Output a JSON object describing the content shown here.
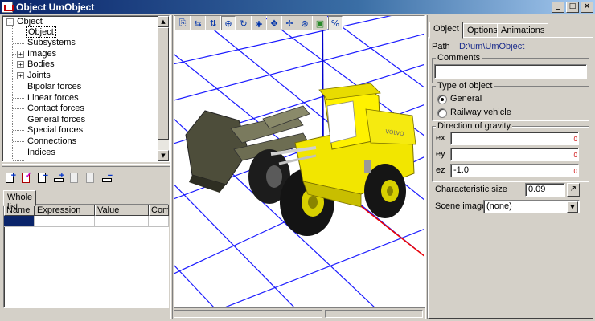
{
  "window": {
    "title": "Object UmObject",
    "controls": [
      "_",
      "□",
      "×"
    ]
  },
  "tree": {
    "items": [
      {
        "label": "Object",
        "level": 0,
        "expander": "-"
      },
      {
        "label": "Object",
        "level": 1,
        "selected": true
      },
      {
        "label": "Subsystems",
        "level": 1
      },
      {
        "label": "Images",
        "level": 1,
        "expander": "+"
      },
      {
        "label": "Bodies",
        "level": 1,
        "expander": "+"
      },
      {
        "label": "Joints",
        "level": 1,
        "expander": "+"
      },
      {
        "label": "Bipolar forces",
        "level": 1
      },
      {
        "label": "Linear forces",
        "level": 1
      },
      {
        "label": "Contact forces",
        "level": 1
      },
      {
        "label": "General forces",
        "level": 1
      },
      {
        "label": "Special forces",
        "level": 1
      },
      {
        "label": "Connections",
        "level": 1
      },
      {
        "label": "Indices",
        "level": 1
      }
    ]
  },
  "left_toolbar": {
    "icons": [
      "add-page-icon",
      "add-pink-page-icon",
      "delete-page-icon",
      "add-row-icon",
      "edit-disabled-icon",
      "copy-disabled-icon",
      "remove-row-icon"
    ]
  },
  "left_tabs": [
    {
      "label": "Whole list"
    }
  ],
  "grid": {
    "columns": [
      "Name",
      "Expression",
      "Value",
      "Comm"
    ]
  },
  "view_toolbar": {
    "icons": [
      "copy-icon",
      "rotate-axes-icon",
      "flip-icon",
      "center-icon",
      "rotate-icon",
      "orbit-icon",
      "pan-icon",
      "move-icon",
      "zoom-icon",
      "box-icon",
      "percent-icon"
    ]
  },
  "right_tabs": [
    {
      "label": "Object"
    },
    {
      "label": "Options"
    },
    {
      "label": "Animations"
    }
  ],
  "object_panel": {
    "path_label": "Path",
    "path_value": "D:\\um\\UmObject",
    "comments_label": "Comments",
    "comments_value": "",
    "type_label": "Type of object",
    "type_options": [
      "General",
      "Railway vehicle"
    ],
    "type_selected": "General",
    "gravity_label": "Direction of gravity",
    "gravity": [
      {
        "axis": "ex",
        "value": ""
      },
      {
        "axis": "ey",
        "value": ""
      },
      {
        "axis": "ez",
        "value": "-1.0"
      }
    ],
    "char_size_label": "Characteristic size",
    "char_size_value": "0.09",
    "scene_image_label": "Scene image",
    "scene_image_value": "(none)"
  },
  "colors": {
    "titlebar": "#0a246a",
    "loader_yellow": "#f2e600",
    "grid_blue": "#0000ff",
    "axis_red": "#ff0000",
    "link_blue": "#1a2b8c"
  }
}
